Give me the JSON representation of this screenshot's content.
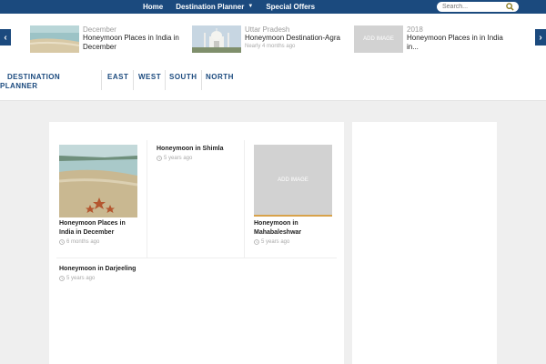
{
  "topnav": {
    "items": [
      {
        "label": "Home"
      },
      {
        "label": "Destination Planner",
        "has_dropdown": true
      },
      {
        "label": "Special Offers"
      }
    ],
    "search_placeholder": "Search...",
    "colors": {
      "bar": "#1b4a7e"
    }
  },
  "carousel": {
    "slides": [
      {
        "category": "December",
        "title": "Honeymoon Places in India in December",
        "date": "",
        "image": "beach-photo"
      },
      {
        "category": "Uttar Pradesh",
        "title": "Honeymoon Destination-Agra",
        "date": "Nearly 4 months ago",
        "image": "taj-mahal-photo"
      },
      {
        "category": "2018",
        "title": "Honeymoon Places in in India in...",
        "date": "",
        "image": "add-image-placeholder",
        "image_text": "ADD IMAGE"
      }
    ]
  },
  "subnav": {
    "brand": "DESTINATION PLANNER",
    "links": [
      "EAST",
      "WEST",
      "SOUTH",
      "NORTH"
    ]
  },
  "posts": [
    {
      "title": "Honeymoon Places in India in December",
      "date": "6 months ago",
      "image": "beach-starfish-photo"
    },
    {
      "title": "Honeymoon in Shimla",
      "date": "5 years ago",
      "image": ""
    },
    {
      "title": "Honeymoon in Mahabaleshwar",
      "date": "5 years ago",
      "image": "add-image-placeholder",
      "image_text": "ADD IMAGE"
    },
    {
      "title": "Honeymoon in Darjeeling",
      "date": "5 years ago",
      "image": ""
    }
  ]
}
